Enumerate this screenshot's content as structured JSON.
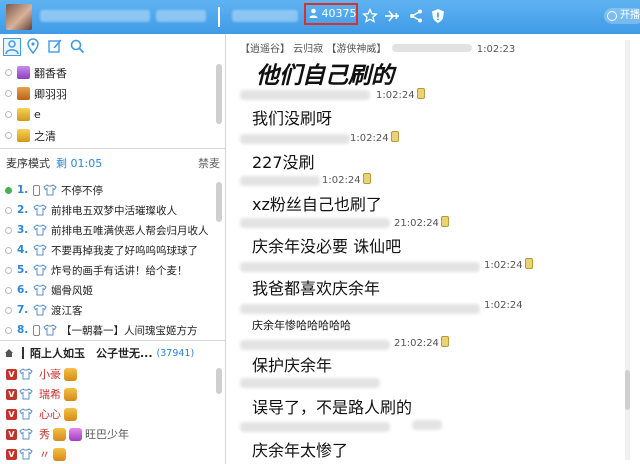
{
  "topbar": {
    "viewer_count": "40375",
    "follow_label": "开播",
    "accent_color": "#3f9be6",
    "icons": [
      "user-icon",
      "star-icon",
      "plane-icon",
      "share-icon",
      "shield-icon"
    ]
  },
  "left_tabs": [
    "user-icon",
    "location-icon",
    "edit-icon",
    "search-icon"
  ],
  "vip_list": [
    {
      "name": "翻香香"
    },
    {
      "name": "卿羽羽"
    },
    {
      "name": "e"
    },
    {
      "name": "之清"
    }
  ],
  "queue": {
    "mode_label": "麦序模式",
    "timer_label": "剩 01:05",
    "ban_label": "禁麦",
    "items": [
      {
        "num": "1.",
        "name": "不停不停"
      },
      {
        "num": "2.",
        "name": "前排电五双梦中活璀璨收人"
      },
      {
        "num": "3.",
        "name": "前排电五唯满侠恶人帮会归月收人"
      },
      {
        "num": "4.",
        "name": "不要再掉我麦了好呜呜呜球球了"
      },
      {
        "num": "5.",
        "name": "炸号的画手有话讲！给个麦！"
      },
      {
        "num": "6.",
        "name": "媚骨风姬"
      },
      {
        "num": "7.",
        "name": "渡江客"
      },
      {
        "num": "8.",
        "name": "【一朝暮一】人间瑰宝姬方方"
      }
    ]
  },
  "fans": {
    "anchor_label": "陌上人如玉　公子世无...",
    "count": "(37941)",
    "members": [
      {
        "name": "小豪"
      },
      {
        "name": "瑞希"
      },
      {
        "name": "心心"
      },
      {
        "name": "秀",
        "extra": "旺巴少年"
      },
      {
        "name": "〃"
      }
    ]
  },
  "chat": {
    "header_meta": "【逍遥谷】 云归寂 【游侠神威】",
    "header_time": "1:02:23",
    "messages": [
      {
        "text": "他们自己刷的",
        "time": ""
      },
      {
        "text": "我们没刷呀",
        "time": "1:02:24"
      },
      {
        "text": "227没刷",
        "time": "1:02:24"
      },
      {
        "text": "xz粉丝自己也刷了",
        "time": "1:02:24"
      },
      {
        "text": "庆余年没必要 诛仙吧",
        "time": "21:02:24"
      },
      {
        "text": "我爸都喜欢庆余年",
        "time": "1:02:24"
      },
      {
        "text": "庆余年惨哈哈哈哈哈",
        "time": "1:02:24"
      },
      {
        "text": "保护庆余年",
        "time": "21:02:24"
      },
      {
        "text": "误导了，不是路人刷的",
        "time": ""
      },
      {
        "text": "庆余年太惨了",
        "time": ""
      }
    ]
  }
}
